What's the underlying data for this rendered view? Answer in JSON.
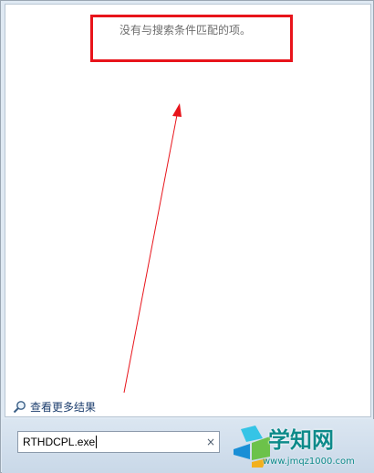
{
  "results": {
    "no_results_text": "没有与搜索条件匹配的项。",
    "see_more_label": "查看更多结果"
  },
  "search": {
    "value": "RTHDCPL.exe",
    "clear_glyph": "×"
  },
  "watermark": {
    "title": "学知网",
    "url": "www.jmqz1000.com"
  },
  "annotation": {
    "color": "#e8141b"
  },
  "icons": {
    "see_more": "magnifier-icon",
    "clear": "close-icon",
    "watermark_logo": "windows-logo-icon"
  }
}
